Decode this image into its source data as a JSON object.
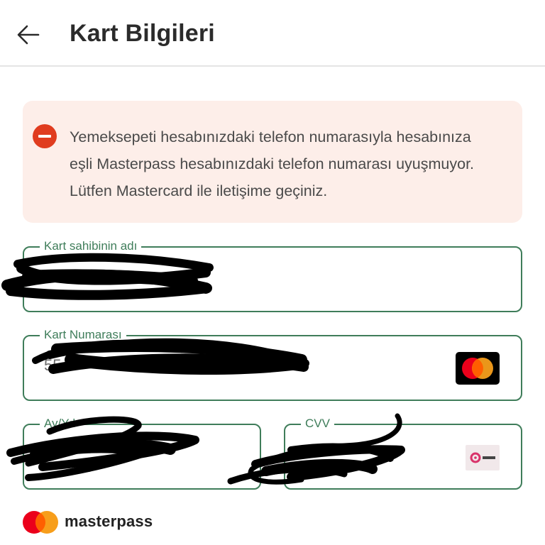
{
  "header": {
    "title": "Kart Bilgileri",
    "back_icon": "arrow-left-icon"
  },
  "alert": {
    "icon": "minus-circle-icon",
    "color": "#e03c1f",
    "lines": [
      "Yemeksepeti hesabınızdaki telefon numarasıyla hesabınıza",
      "eşli Masterpass hesabınızdaki telefon numarası uyuşmuyor.",
      "Lütfen Mastercard ile iletişime geçiniz."
    ]
  },
  "form": {
    "cardholder": {
      "label": "Kart sahibinin adı",
      "value": "B"
    },
    "card_number": {
      "label": "Kart Numarası",
      "value": "55",
      "brand_icon": "mastercard-icon"
    },
    "expiry": {
      "label": "Ay/Yıl",
      "value": ""
    },
    "cvv": {
      "label": "CVV",
      "value": "",
      "icon": "cvv-card-icon"
    }
  },
  "footer": {
    "brand_text": "masterpass",
    "logo_icon": "masterpass-logo-icon"
  },
  "colors": {
    "accent": "#3f7d5a",
    "alert_bg": "#fdeee9",
    "mastercard_red": "#eb001b",
    "mastercard_orange": "#f79e1b"
  }
}
